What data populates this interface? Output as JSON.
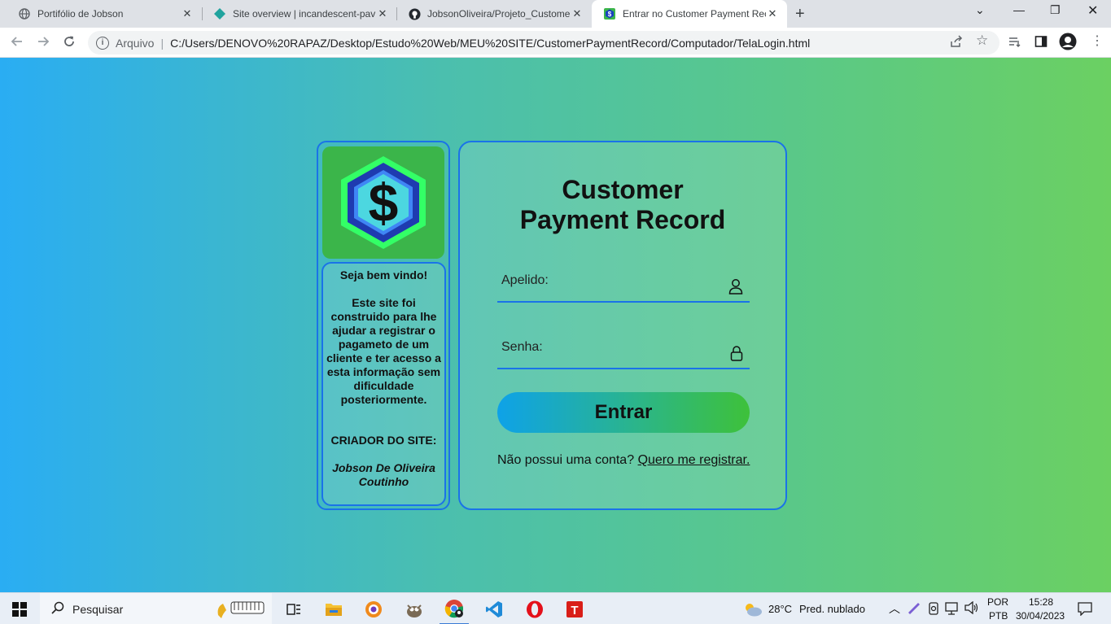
{
  "browser": {
    "tabs": [
      {
        "title": "Portifólio de Jobson",
        "icon": "globe-icon"
      },
      {
        "title": "Site overview | incandescent-pav",
        "icon": "netlify-icon"
      },
      {
        "title": "JobsonOliveira/Projeto_Custome",
        "icon": "github-icon"
      },
      {
        "title": "Entrar no Customer Payment Rec",
        "icon": "dollar-favicon",
        "active": true
      }
    ],
    "address": {
      "scheme": "Arquivo",
      "url": "C:/Users/DENOVO%20RAPAZ/Desktop/Estudo%20Web/MEU%20SITE/CustomerPaymentRecord/Computador/TelaLogin.html"
    }
  },
  "page": {
    "welcome": "Seja bem vindo!",
    "description": "Este site foi construido para lhe ajudar a registrar o pagameto de um cliente e ter acesso a esta informação sem dificuldade posteriormente.",
    "creator_label": "CRIADOR DO SITE:",
    "creator_name": "Jobson De Oliveira Coutinho",
    "title_line1": "Customer",
    "title_line2": "Payment Record",
    "username_label": "Apelido:",
    "password_label": "Senha:",
    "submit_label": "Entrar",
    "register_prompt": "Não possui uma conta?",
    "register_link": "Quero me registrar.",
    "colors": {
      "border": "#1a73e8",
      "logo_bg": "#3bb54a",
      "gradient_start": "#2aadf3",
      "gradient_end": "#6bd062"
    }
  },
  "taskbar": {
    "search_placeholder": "Pesquisar",
    "weather_temp": "28°C",
    "weather_text": "Pred. nublado",
    "lang_top": "POR",
    "lang_bottom": "PTB",
    "time": "15:28",
    "date": "30/04/2023"
  }
}
